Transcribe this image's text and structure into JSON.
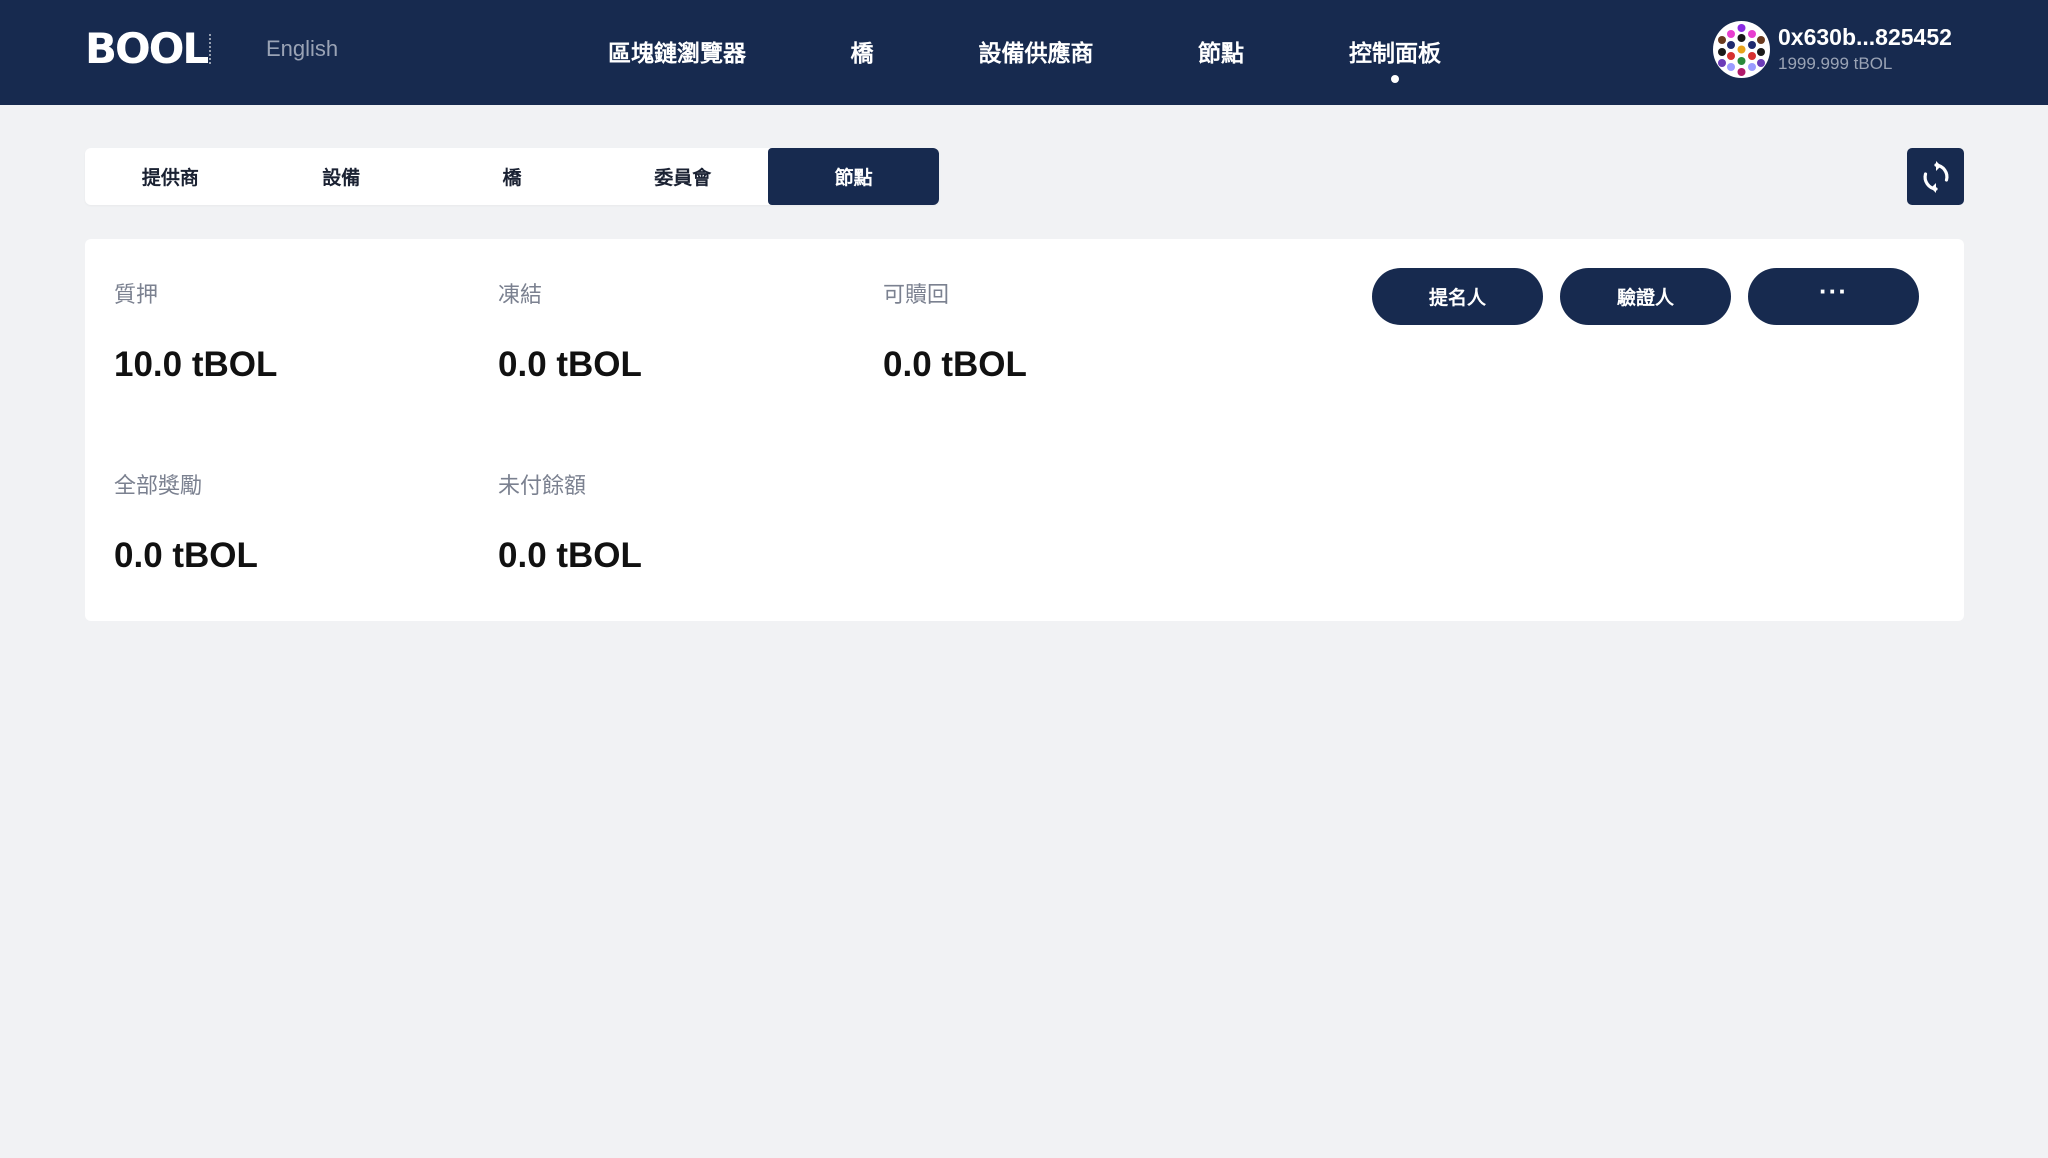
{
  "header": {
    "logo_text": "BOOL",
    "language": "English",
    "nav": [
      {
        "label": "區塊鏈瀏覽器"
      },
      {
        "label": "橋"
      },
      {
        "label": "設備供應商"
      },
      {
        "label": "節點"
      },
      {
        "label": "控制面板",
        "active": true
      }
    ],
    "account": {
      "address": "0x630b...825452",
      "balance": "1999.999 tBOL"
    }
  },
  "tabs": [
    {
      "label": "提供商"
    },
    {
      "label": "設備"
    },
    {
      "label": "橋"
    },
    {
      "label": "委員會"
    },
    {
      "label": "節點",
      "active": true
    }
  ],
  "refresh_icon": "refresh-icon",
  "stats": {
    "staked": {
      "label": "質押",
      "value": "10.0 tBOL"
    },
    "frozen": {
      "label": "凍結",
      "value": "0.0 tBOL"
    },
    "redeemable": {
      "label": "可贖回",
      "value": "0.0 tBOL"
    },
    "total_rewards": {
      "label": "全部獎勵",
      "value": "0.0 tBOL"
    },
    "unpaid_balance": {
      "label": "未付餘額",
      "value": "0.0 tBOL"
    }
  },
  "actions": {
    "nominator": "提名人",
    "validator": "驗證人",
    "more": "···"
  },
  "colors": {
    "navy": "#172a4f",
    "background": "#f1f2f4",
    "card": "#ffffff",
    "muted_text": "#7b8190"
  }
}
